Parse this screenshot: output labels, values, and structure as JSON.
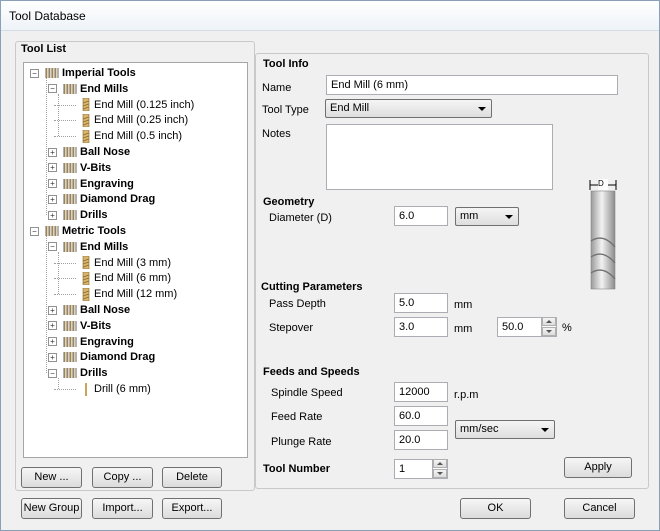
{
  "window": {
    "title": "Tool Database"
  },
  "tool_list": {
    "heading": "Tool List",
    "tree": [
      {
        "label": "Imperial Tools",
        "level": 0,
        "expanded": true,
        "kind": "group"
      },
      {
        "label": "End Mills",
        "level": 1,
        "expanded": true,
        "kind": "group"
      },
      {
        "label": "End Mill (0.125 inch)",
        "level": 2,
        "kind": "tool"
      },
      {
        "label": "End Mill (0.25 inch)",
        "level": 2,
        "kind": "tool"
      },
      {
        "label": "End Mill (0.5 inch)",
        "level": 2,
        "kind": "tool"
      },
      {
        "label": "Ball Nose",
        "level": 1,
        "expanded": false,
        "kind": "group"
      },
      {
        "label": "V-Bits",
        "level": 1,
        "expanded": false,
        "kind": "group"
      },
      {
        "label": "Engraving",
        "level": 1,
        "expanded": false,
        "kind": "group"
      },
      {
        "label": "Diamond Drag",
        "level": 1,
        "expanded": false,
        "kind": "group"
      },
      {
        "label": "Drills",
        "level": 1,
        "expanded": false,
        "kind": "group"
      },
      {
        "label": "Metric Tools",
        "level": 0,
        "expanded": true,
        "kind": "group"
      },
      {
        "label": "End Mills",
        "level": 1,
        "expanded": true,
        "kind": "group"
      },
      {
        "label": "End Mill (3 mm)",
        "level": 2,
        "kind": "tool"
      },
      {
        "label": "End Mill (6 mm)",
        "level": 2,
        "kind": "tool"
      },
      {
        "label": "End Mill (12 mm)",
        "level": 2,
        "kind": "tool"
      },
      {
        "label": "Ball Nose",
        "level": 1,
        "expanded": false,
        "kind": "group"
      },
      {
        "label": "V-Bits",
        "level": 1,
        "expanded": false,
        "kind": "group"
      },
      {
        "label": "Engraving",
        "level": 1,
        "expanded": false,
        "kind": "group"
      },
      {
        "label": "Diamond Drag",
        "level": 1,
        "expanded": false,
        "kind": "group"
      },
      {
        "label": "Drills",
        "level": 1,
        "expanded": true,
        "kind": "group"
      },
      {
        "label": "Drill (6 mm)",
        "level": 2,
        "kind": "drill"
      }
    ],
    "buttons": {
      "new": "New ...",
      "copy": "Copy ...",
      "delete": "Delete",
      "new_group": "New Group",
      "import": "Import...",
      "export": "Export..."
    }
  },
  "tool_info": {
    "heading": "Tool Info",
    "name_label": "Name",
    "name_value": "End Mill (6 mm)",
    "type_label": "Tool Type",
    "type_value": "End Mill",
    "notes_label": "Notes",
    "notes_value": ""
  },
  "diagram": {
    "label": "D"
  },
  "geometry": {
    "heading": "Geometry",
    "diameter_label": "Diameter (D)",
    "diameter_value": "6.0",
    "units_value": "mm"
  },
  "cutting": {
    "heading": "Cutting Parameters",
    "pass_depth_label": "Pass Depth",
    "pass_depth_value": "5.0",
    "pass_depth_unit": "mm",
    "stepover_label": "Stepover",
    "stepover_value": "3.0",
    "stepover_unit": "mm",
    "stepover_percent": "50.0",
    "percent_symbol": "%"
  },
  "feeds": {
    "heading": "Feeds and Speeds",
    "spindle_label": "Spindle Speed",
    "spindle_value": "12000",
    "spindle_unit": "r.p.m",
    "feed_label": "Feed Rate",
    "feed_value": "60.0",
    "plunge_label": "Plunge Rate",
    "plunge_value": "20.0",
    "rate_units": "mm/sec"
  },
  "tool_number": {
    "label": "Tool Number",
    "value": "1"
  },
  "actions": {
    "apply": "Apply",
    "ok": "OK",
    "cancel": "Cancel"
  }
}
